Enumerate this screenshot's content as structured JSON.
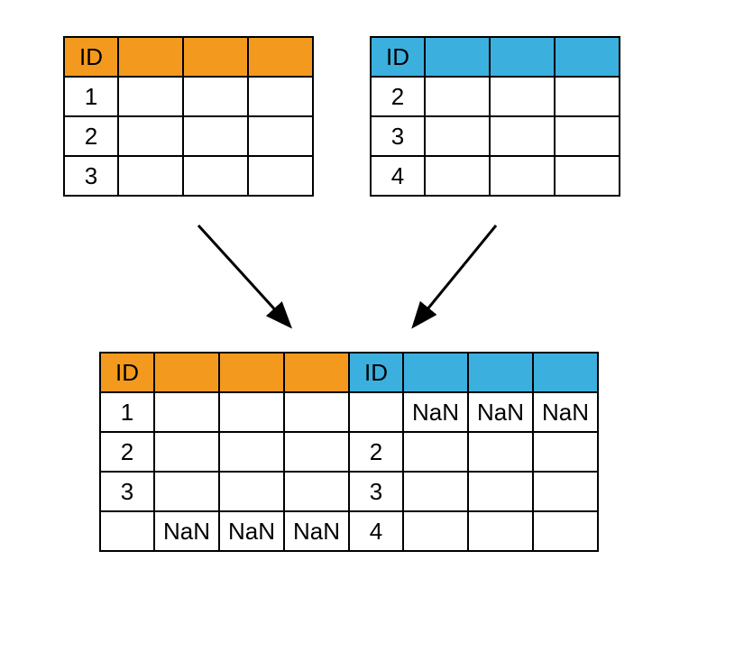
{
  "left_table": {
    "header": "ID",
    "rows": [
      "1",
      "2",
      "3"
    ]
  },
  "right_table": {
    "header": "ID",
    "rows": [
      "2",
      "3",
      "4"
    ]
  },
  "merged_table": {
    "left_header": "ID",
    "right_header": "ID",
    "nan": "NaN",
    "rows": [
      {
        "left_id": "1",
        "right_id": "",
        "right_vals": [
          "NaN",
          "NaN",
          "NaN"
        ],
        "left_vals": [
          "",
          "",
          ""
        ]
      },
      {
        "left_id": "2",
        "right_id": "2",
        "right_vals": [
          "",
          "",
          ""
        ],
        "left_vals": [
          "",
          "",
          ""
        ]
      },
      {
        "left_id": "3",
        "right_id": "3",
        "right_vals": [
          "",
          "",
          ""
        ],
        "left_vals": [
          "",
          "",
          ""
        ]
      },
      {
        "left_id": "",
        "right_id": "4",
        "right_vals": [
          "",
          "",
          ""
        ],
        "left_vals": [
          "NaN",
          "NaN",
          "NaN"
        ]
      }
    ]
  }
}
